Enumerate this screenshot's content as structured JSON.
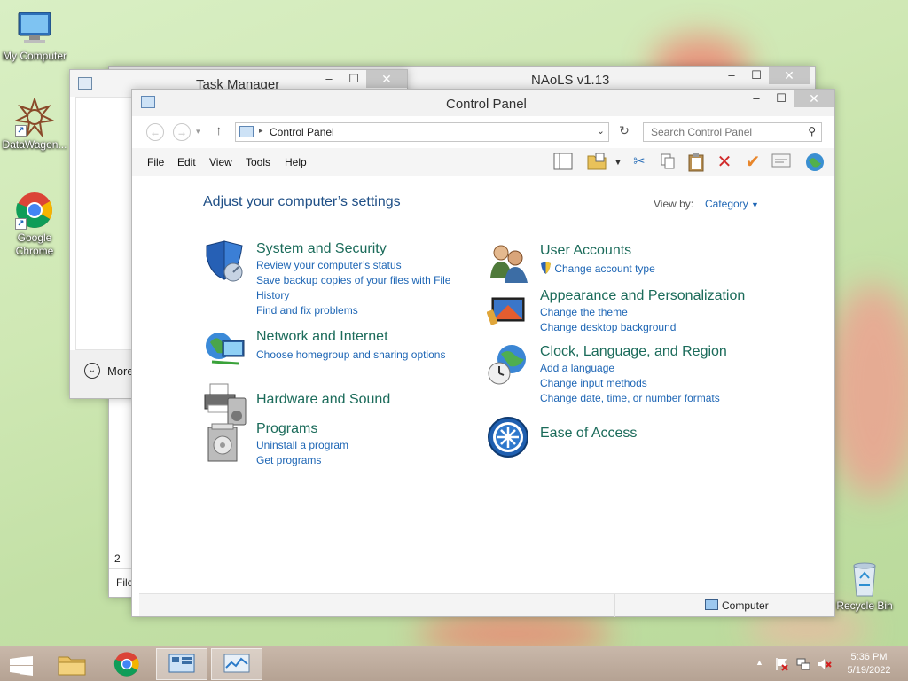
{
  "desktop": {
    "icons": [
      {
        "label": "My Computer"
      },
      {
        "label": "DataWagon..."
      },
      {
        "label": "Google Chrome"
      },
      {
        "label": "Recycle Bin"
      }
    ]
  },
  "task_manager": {
    "title": "Task Manager",
    "more_details": "More",
    "file_tab": "File",
    "fragment": "2"
  },
  "naols": {
    "title": "NAoLS v1.13"
  },
  "control_panel": {
    "title": "Control Panel",
    "breadcrumb": "Control Panel",
    "search_placeholder": "Search Control Panel",
    "menu": [
      "File",
      "Edit",
      "View",
      "Tools",
      "Help"
    ],
    "heading": "Adjust your computer’s settings",
    "view_by_label": "View by:",
    "view_by_value": "Category",
    "categories": {
      "system_security": {
        "title": "System and Security",
        "links": [
          "Review your computer’s status",
          "Save backup copies of your files with File History",
          "Find and fix problems"
        ]
      },
      "network": {
        "title": "Network and Internet",
        "links": [
          "Choose homegroup and sharing options"
        ]
      },
      "hardware": {
        "title": "Hardware and Sound"
      },
      "programs": {
        "title": "Programs",
        "links": [
          "Uninstall a program",
          "Get programs"
        ]
      },
      "user_accounts": {
        "title": "User Accounts",
        "links": [
          "Change account type"
        ]
      },
      "appearance": {
        "title": "Appearance and Personalization",
        "links": [
          "Change the theme",
          "Change desktop background"
        ]
      },
      "clock": {
        "title": "Clock, Language, and Region",
        "links": [
          "Add a language",
          "Change input methods",
          "Change date, time, or number formats"
        ]
      },
      "ease": {
        "title": "Ease of Access"
      }
    },
    "status_location": "Computer"
  },
  "taskbar": {
    "time": "5:36 PM",
    "date": "5/19/2022"
  }
}
